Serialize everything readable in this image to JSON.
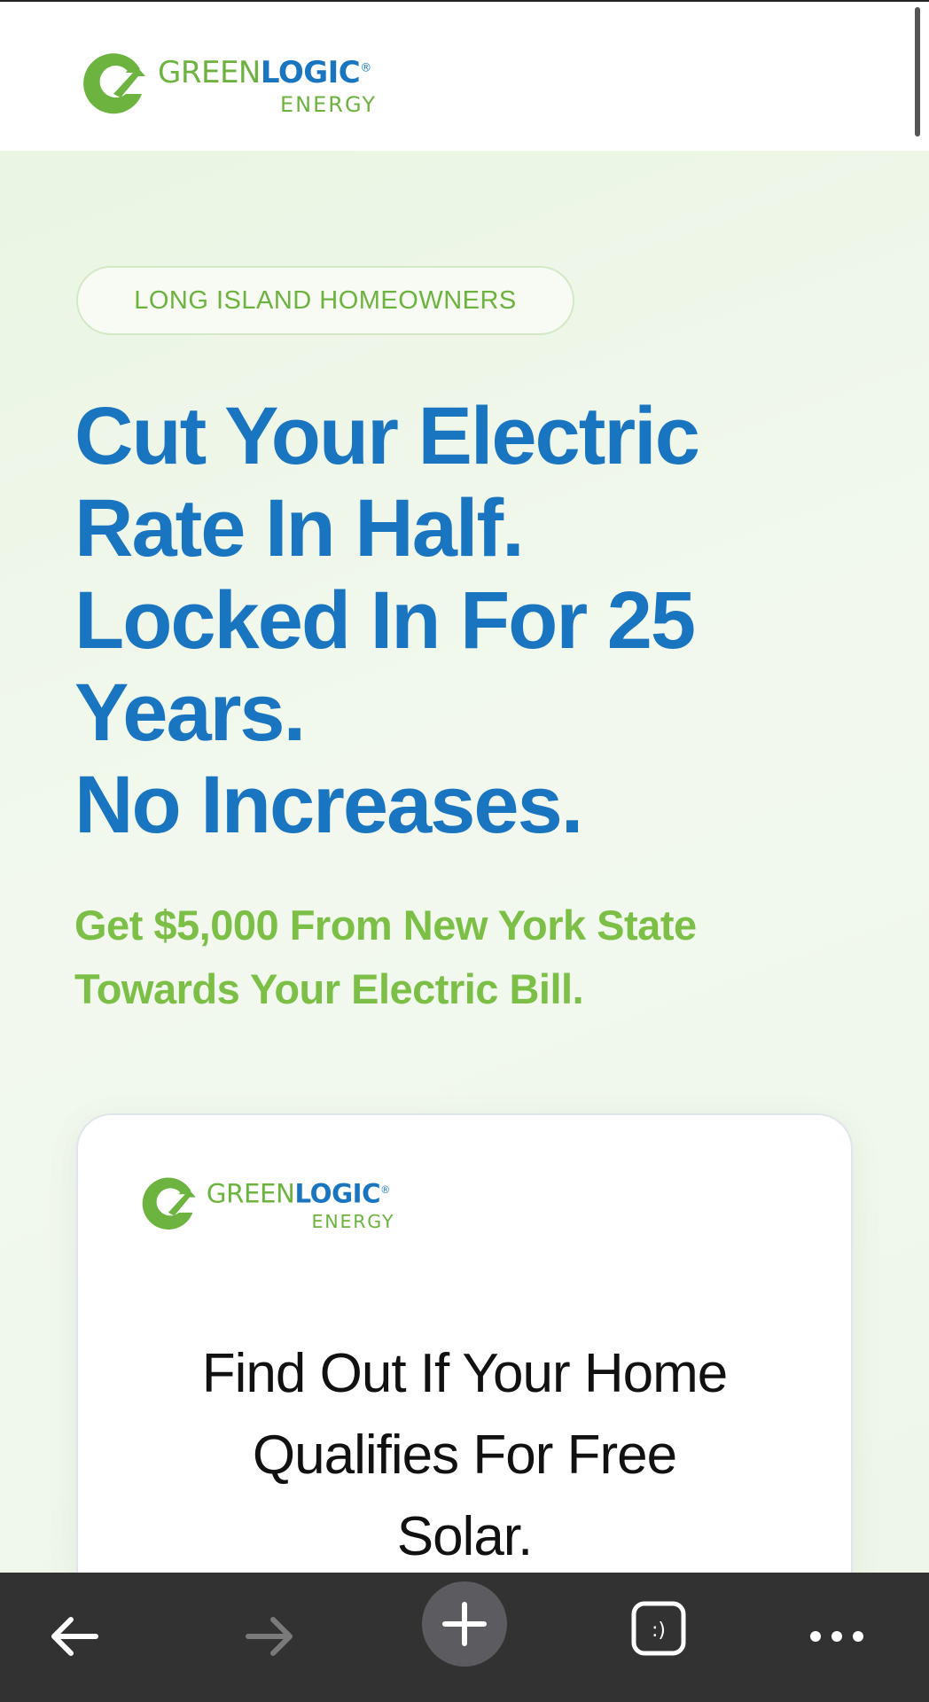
{
  "header": {
    "logo": {
      "name_green": "GREEN",
      "name_blue": "LOGIC",
      "registered": "®",
      "sub": "ENERGY"
    }
  },
  "hero": {
    "badge": "LONG ISLAND HOMEOWNERS",
    "headline_lines": [
      "Cut Your Electric",
      "Rate In Half.",
      "Locked In For 25",
      "Years.",
      "No Increases."
    ],
    "subhead_lines": [
      "Get $5,000 From New York State",
      "Towards Your Electric Bill."
    ]
  },
  "card": {
    "logo": {
      "name_green": "GREEN",
      "name_blue": "LOGIC",
      "registered": "®",
      "sub": "ENERGY"
    },
    "title_lines": [
      "Find Out If Your Home",
      "Qualifies For Free",
      "Solar."
    ]
  },
  "browser_bar": {
    "tabs_label": ":)",
    "icons": [
      "back-arrow-icon",
      "forward-arrow-icon",
      "plus-icon",
      "tab-switcher-icon",
      "more-dots-icon"
    ]
  },
  "colors": {
    "brand_green": "#6db33f",
    "brand_blue": "#1a75c1",
    "bar_background": "#323232"
  }
}
